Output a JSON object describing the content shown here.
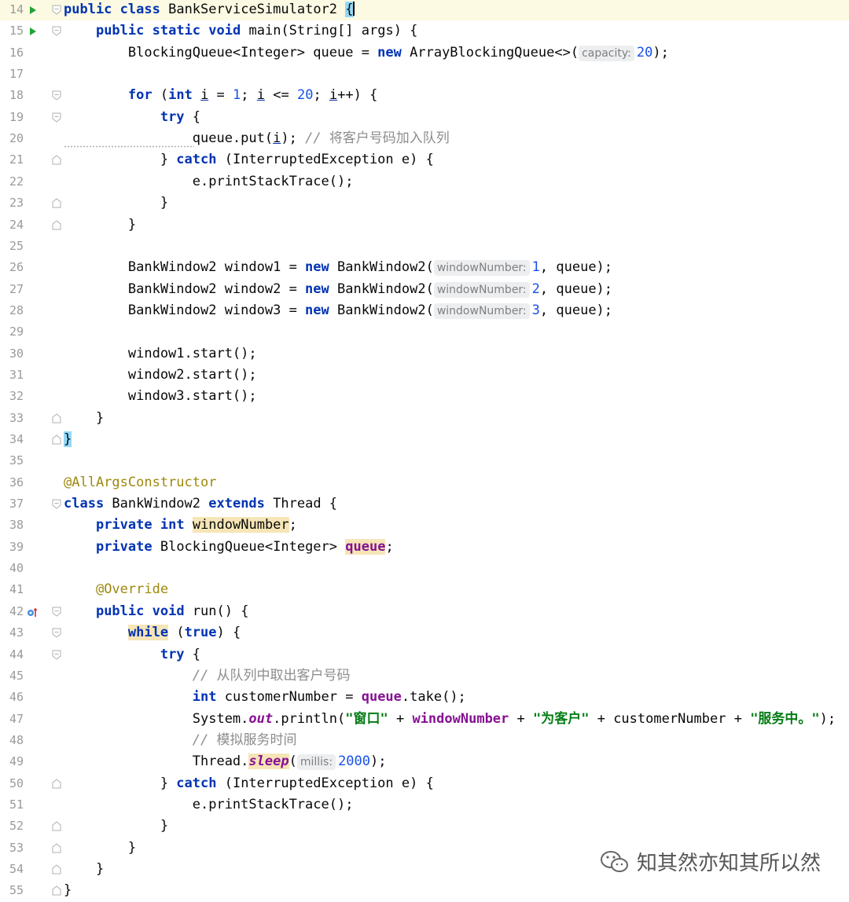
{
  "editor": {
    "lines": [
      {
        "n": "14",
        "tokens": [
          [
            "kw",
            "public"
          ],
          [
            "t",
            " "
          ],
          [
            "kw",
            "class"
          ],
          [
            "t",
            " BankServiceSimulator2 "
          ],
          [
            "brace",
            "{"
          ]
        ],
        "run": true,
        "fold": "open",
        "current": true
      },
      {
        "n": "15",
        "tokens": [
          [
            "t",
            "    "
          ],
          [
            "kw",
            "public"
          ],
          [
            "t",
            " "
          ],
          [
            "kw",
            "static"
          ],
          [
            "t",
            " "
          ],
          [
            "kw",
            "void"
          ],
          [
            "t",
            " main(String[] args) {"
          ]
        ],
        "run": true,
        "fold": "open"
      },
      {
        "n": "16",
        "tokens": [
          [
            "t",
            "        BlockingQueue<Integer> queue = "
          ],
          [
            "kw",
            "new"
          ],
          [
            "t",
            " ArrayBlockingQueue<>("
          ],
          [
            "hint",
            "capacity:"
          ],
          [
            "num",
            "20"
          ],
          [
            "t",
            ");"
          ]
        ]
      },
      {
        "n": "17",
        "tokens": []
      },
      {
        "n": "18",
        "tokens": [
          [
            "t",
            "        "
          ],
          [
            "kw",
            "for"
          ],
          [
            "t",
            " ("
          ],
          [
            "kw",
            "int"
          ],
          [
            "t",
            " "
          ],
          [
            "ul",
            "i"
          ],
          [
            "t",
            " = "
          ],
          [
            "num",
            "1"
          ],
          [
            "t",
            "; "
          ],
          [
            "ul",
            "i"
          ],
          [
            "t",
            " <= "
          ],
          [
            "num",
            "20"
          ],
          [
            "t",
            "; "
          ],
          [
            "ul",
            "i"
          ],
          [
            "t",
            "++) {"
          ]
        ],
        "fold": "open"
      },
      {
        "n": "19",
        "tokens": [
          [
            "t",
            "            "
          ],
          [
            "kw",
            "try"
          ],
          [
            "t",
            " {"
          ]
        ],
        "fold": "open"
      },
      {
        "n": "20",
        "tokens": [
          [
            "t",
            "                queue.put("
          ],
          [
            "ul",
            "i"
          ],
          [
            "t",
            "); "
          ],
          [
            "cmt",
            "// "
          ],
          [
            "cmtc",
            "将客户号码加入队列"
          ]
        ],
        "wave": true
      },
      {
        "n": "21",
        "tokens": [
          [
            "t",
            "            } "
          ],
          [
            "kw",
            "catch"
          ],
          [
            "t",
            " (InterruptedException e) {"
          ]
        ],
        "fold": "close"
      },
      {
        "n": "22",
        "tokens": [
          [
            "t",
            "                e.printStackTrace();"
          ]
        ]
      },
      {
        "n": "23",
        "tokens": [
          [
            "t",
            "            }"
          ]
        ],
        "fold": "close"
      },
      {
        "n": "24",
        "tokens": [
          [
            "t",
            "        }"
          ]
        ],
        "fold": "close"
      },
      {
        "n": "25",
        "tokens": []
      },
      {
        "n": "26",
        "tokens": [
          [
            "t",
            "        BankWindow2 window1 = "
          ],
          [
            "kw",
            "new"
          ],
          [
            "t",
            " BankWindow2("
          ],
          [
            "hint",
            "windowNumber:"
          ],
          [
            "num",
            "1"
          ],
          [
            "t",
            ", queue);"
          ]
        ]
      },
      {
        "n": "27",
        "tokens": [
          [
            "t",
            "        BankWindow2 window2 = "
          ],
          [
            "kw",
            "new"
          ],
          [
            "t",
            " BankWindow2("
          ],
          [
            "hint",
            "windowNumber:"
          ],
          [
            "num",
            "2"
          ],
          [
            "t",
            ", queue);"
          ]
        ]
      },
      {
        "n": "28",
        "tokens": [
          [
            "t",
            "        BankWindow2 window3 = "
          ],
          [
            "kw",
            "new"
          ],
          [
            "t",
            " BankWindow2("
          ],
          [
            "hint",
            "windowNumber:"
          ],
          [
            "num",
            "3"
          ],
          [
            "t",
            ", queue);"
          ]
        ]
      },
      {
        "n": "29",
        "tokens": []
      },
      {
        "n": "30",
        "tokens": [
          [
            "t",
            "        window1.start();"
          ]
        ]
      },
      {
        "n": "31",
        "tokens": [
          [
            "t",
            "        window2.start();"
          ]
        ]
      },
      {
        "n": "32",
        "tokens": [
          [
            "t",
            "        window3.start();"
          ]
        ]
      },
      {
        "n": "33",
        "tokens": [
          [
            "t",
            "    }"
          ]
        ],
        "fold": "close"
      },
      {
        "n": "34",
        "tokens": [
          [
            "brace",
            "}"
          ]
        ],
        "fold": "close"
      },
      {
        "n": "35",
        "tokens": []
      },
      {
        "n": "36",
        "tokens": [
          [
            "anno",
            "@AllArgsConstructor"
          ]
        ]
      },
      {
        "n": "37",
        "tokens": [
          [
            "kw",
            "class"
          ],
          [
            "t",
            " BankWindow2 "
          ],
          [
            "kw",
            "extends"
          ],
          [
            "t",
            " Thread {"
          ]
        ],
        "fold": "open"
      },
      {
        "n": "38",
        "tokens": [
          [
            "t",
            "    "
          ],
          [
            "kw",
            "private"
          ],
          [
            "t",
            " "
          ],
          [
            "kw",
            "int"
          ],
          [
            "t",
            " "
          ],
          [
            "hlfield",
            "windowNumber"
          ],
          [
            "t",
            ";"
          ]
        ]
      },
      {
        "n": "39",
        "tokens": [
          [
            "t",
            "    "
          ],
          [
            "kw",
            "private"
          ],
          [
            "t",
            " BlockingQueue<Integer> "
          ],
          [
            "hlfieldb",
            "queue"
          ],
          [
            "t",
            ";"
          ]
        ]
      },
      {
        "n": "40",
        "tokens": []
      },
      {
        "n": "41",
        "tokens": [
          [
            "t",
            "    "
          ],
          [
            "anno",
            "@Override"
          ]
        ]
      },
      {
        "n": "42",
        "tokens": [
          [
            "t",
            "    "
          ],
          [
            "kw",
            "public"
          ],
          [
            "t",
            " "
          ],
          [
            "kw",
            "void"
          ],
          [
            "t",
            " run() {"
          ]
        ],
        "override": true,
        "fold": "open"
      },
      {
        "n": "43",
        "tokens": [
          [
            "t",
            "        "
          ],
          [
            "hlkw",
            "while"
          ],
          [
            "t",
            " ("
          ],
          [
            "kw",
            "true"
          ],
          [
            "t",
            ") {"
          ]
        ],
        "fold": "open"
      },
      {
        "n": "44",
        "tokens": [
          [
            "t",
            "            "
          ],
          [
            "kw",
            "try"
          ],
          [
            "t",
            " {"
          ]
        ],
        "fold": "open"
      },
      {
        "n": "45",
        "tokens": [
          [
            "t",
            "                "
          ],
          [
            "cmt",
            "// "
          ],
          [
            "cmtc",
            "从队列中取出客户号码"
          ]
        ]
      },
      {
        "n": "46",
        "tokens": [
          [
            "t",
            "                "
          ],
          [
            "kw",
            "int"
          ],
          [
            "t",
            " customerNumber = "
          ],
          [
            "field",
            "queue"
          ],
          [
            "t",
            ".take();"
          ]
        ]
      },
      {
        "n": "47",
        "tokens": [
          [
            "t",
            "                System."
          ],
          [
            "static",
            "out"
          ],
          [
            "t",
            ".println("
          ],
          [
            "str",
            "\"窗口\""
          ],
          [
            "t",
            " + "
          ],
          [
            "fieldg",
            "windowNumber"
          ],
          [
            "t",
            " + "
          ],
          [
            "str",
            "\"为客户\""
          ],
          [
            "t",
            " + customerNumber + "
          ],
          [
            "str",
            "\"服务中。\""
          ],
          [
            "t",
            ");"
          ]
        ]
      },
      {
        "n": "48",
        "tokens": [
          [
            "t",
            "                "
          ],
          [
            "cmt",
            "// "
          ],
          [
            "cmtc",
            "模拟服务时间"
          ]
        ]
      },
      {
        "n": "49",
        "tokens": [
          [
            "t",
            "                Thread."
          ],
          [
            "hlstatic",
            "sleep"
          ],
          [
            "t",
            "("
          ],
          [
            "hint",
            "millis:"
          ],
          [
            "num",
            "2000"
          ],
          [
            "t",
            ");"
          ]
        ]
      },
      {
        "n": "50",
        "tokens": [
          [
            "t",
            "            } "
          ],
          [
            "kw",
            "catch"
          ],
          [
            "t",
            " (InterruptedException e) {"
          ]
        ],
        "fold": "close"
      },
      {
        "n": "51",
        "tokens": [
          [
            "t",
            "                e.printStackTrace();"
          ]
        ]
      },
      {
        "n": "52",
        "tokens": [
          [
            "t",
            "            }"
          ]
        ],
        "fold": "close"
      },
      {
        "n": "53",
        "tokens": [
          [
            "t",
            "        }"
          ]
        ],
        "fold": "close"
      },
      {
        "n": "54",
        "tokens": [
          [
            "t",
            "    }"
          ]
        ],
        "fold": "close"
      },
      {
        "n": "55",
        "tokens": [
          [
            "t",
            "}"
          ]
        ],
        "fold": "close"
      }
    ]
  },
  "watermark": {
    "text": "知其然亦知其所以然",
    "icon": "wechat-icon"
  },
  "colors": {
    "keyword": "#0033b3",
    "number": "#1750eb",
    "string": "#067d17",
    "comment": "#8c8c8c",
    "annotation": "#9e880d",
    "field": "#871094",
    "run_icon": "#21a336",
    "current_line": "#fcfae3"
  }
}
